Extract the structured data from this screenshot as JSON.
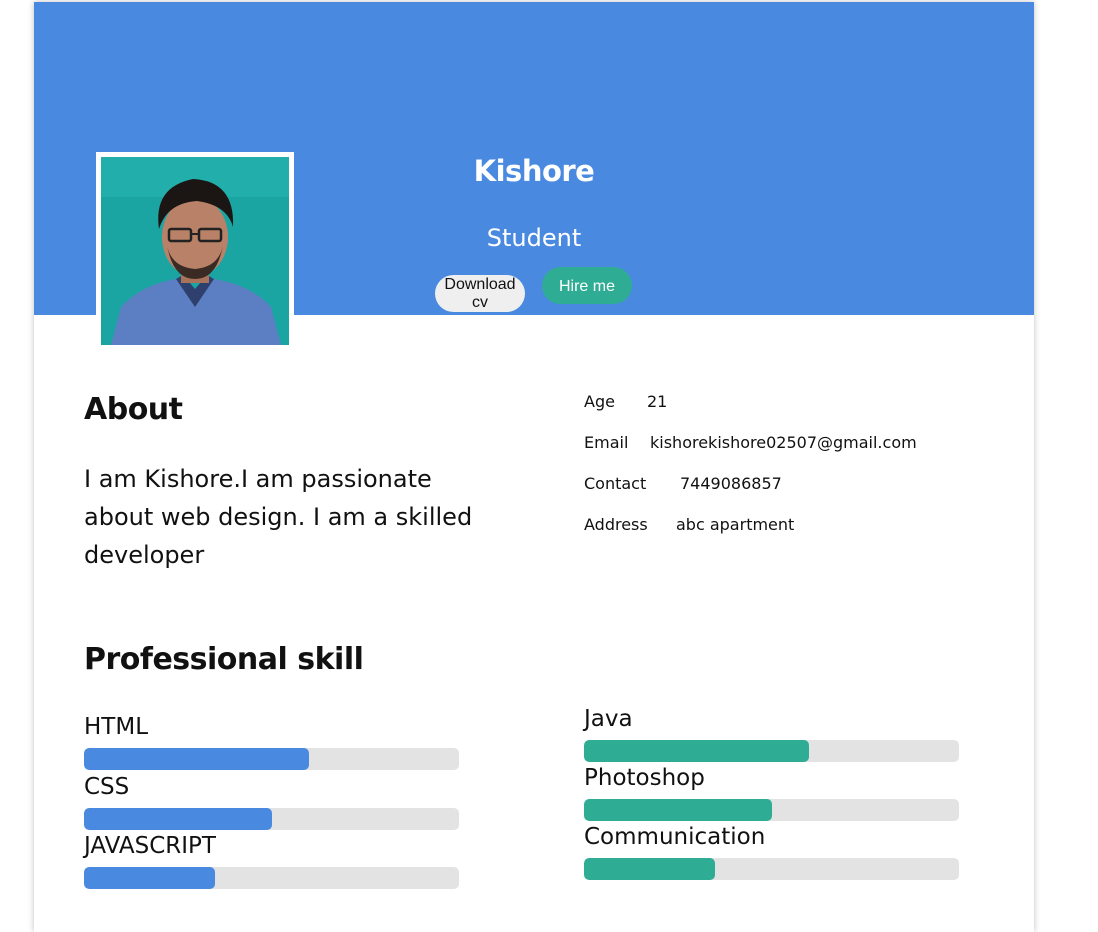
{
  "profile": {
    "name": "Kishore",
    "role": "Student",
    "download_label": "Download cv",
    "hire_label": "Hire me"
  },
  "about": {
    "title": "About",
    "text": "I am Kishore.I am passionate about web design. I am a skilled developer"
  },
  "info": [
    {
      "label": "Age",
      "value": "21"
    },
    {
      "label": "Email",
      "value": "kishorekishore02507@gmail.com"
    },
    {
      "label": "Contact",
      "value": "7449086857"
    },
    {
      "label": "Address",
      "value": "abc apartment"
    }
  ],
  "skills": {
    "title": "Professional skill",
    "left": [
      {
        "name": "HTML",
        "level": 0.6
      },
      {
        "name": "CSS",
        "level": 0.5
      },
      {
        "name": "JAVASCRIPT",
        "level": 0.35
      }
    ],
    "right": [
      {
        "name": "Java",
        "level": 0.6
      },
      {
        "name": "Photoshop",
        "level": 0.5
      },
      {
        "name": "Communication",
        "level": 0.35
      }
    ]
  },
  "colors": {
    "banner": "#4a89e0",
    "accent_green": "#2fad94",
    "track": "#e3e3e3"
  },
  "icons": {
    "photo": "profile-photo"
  }
}
